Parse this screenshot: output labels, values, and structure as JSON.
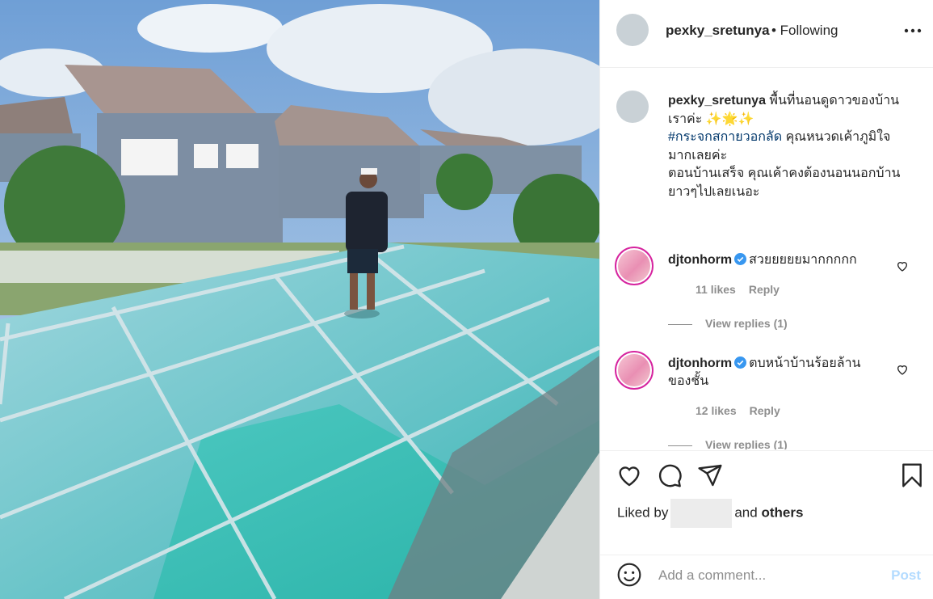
{
  "post": {
    "username": "pexky_sretunya",
    "follow_status": "• Following",
    "caption_user": "pexky_sretunya",
    "caption_line1": " พื้นที่นอนดูดาวของบ้าน เราค่ะ ✨🌟✨",
    "hashtag": "#กระจกสกายวอกลัด",
    "caption_line2": " คุณหนวดเค้าภูมิใจ มากเลยค่ะ",
    "caption_line3": "ตอนบ้านเสร็จ คุณเค้าคงต้องนอนนอกบ้าน ยาวๆไปเลยเนอะ"
  },
  "comments": [
    {
      "username": "djtonhorm",
      "text": "สวยยยยยมากกกกก",
      "likes": "11 likes",
      "reply": "Reply",
      "view_replies": "View replies (1)"
    },
    {
      "username": "djtonhorm",
      "text": "ตบหน้าบ้านร้อยล้าน ของชั้น",
      "likes": "12 likes",
      "reply": "Reply",
      "view_replies": "View replies (1)"
    }
  ],
  "likes": {
    "prefix": "Liked by",
    "and": "and",
    "others": "others"
  },
  "composer": {
    "placeholder": "Add a comment...",
    "post_label": "Post"
  },
  "icons": [
    "more-icon",
    "verified-icon",
    "heart-icon",
    "comment-icon",
    "share-icon",
    "bookmark-icon",
    "smile-icon"
  ],
  "colors": {
    "verified": "#3897f0",
    "hashtag": "#00376b",
    "post_disabled": "#b3dbff",
    "muted": "#8e8e8e"
  }
}
